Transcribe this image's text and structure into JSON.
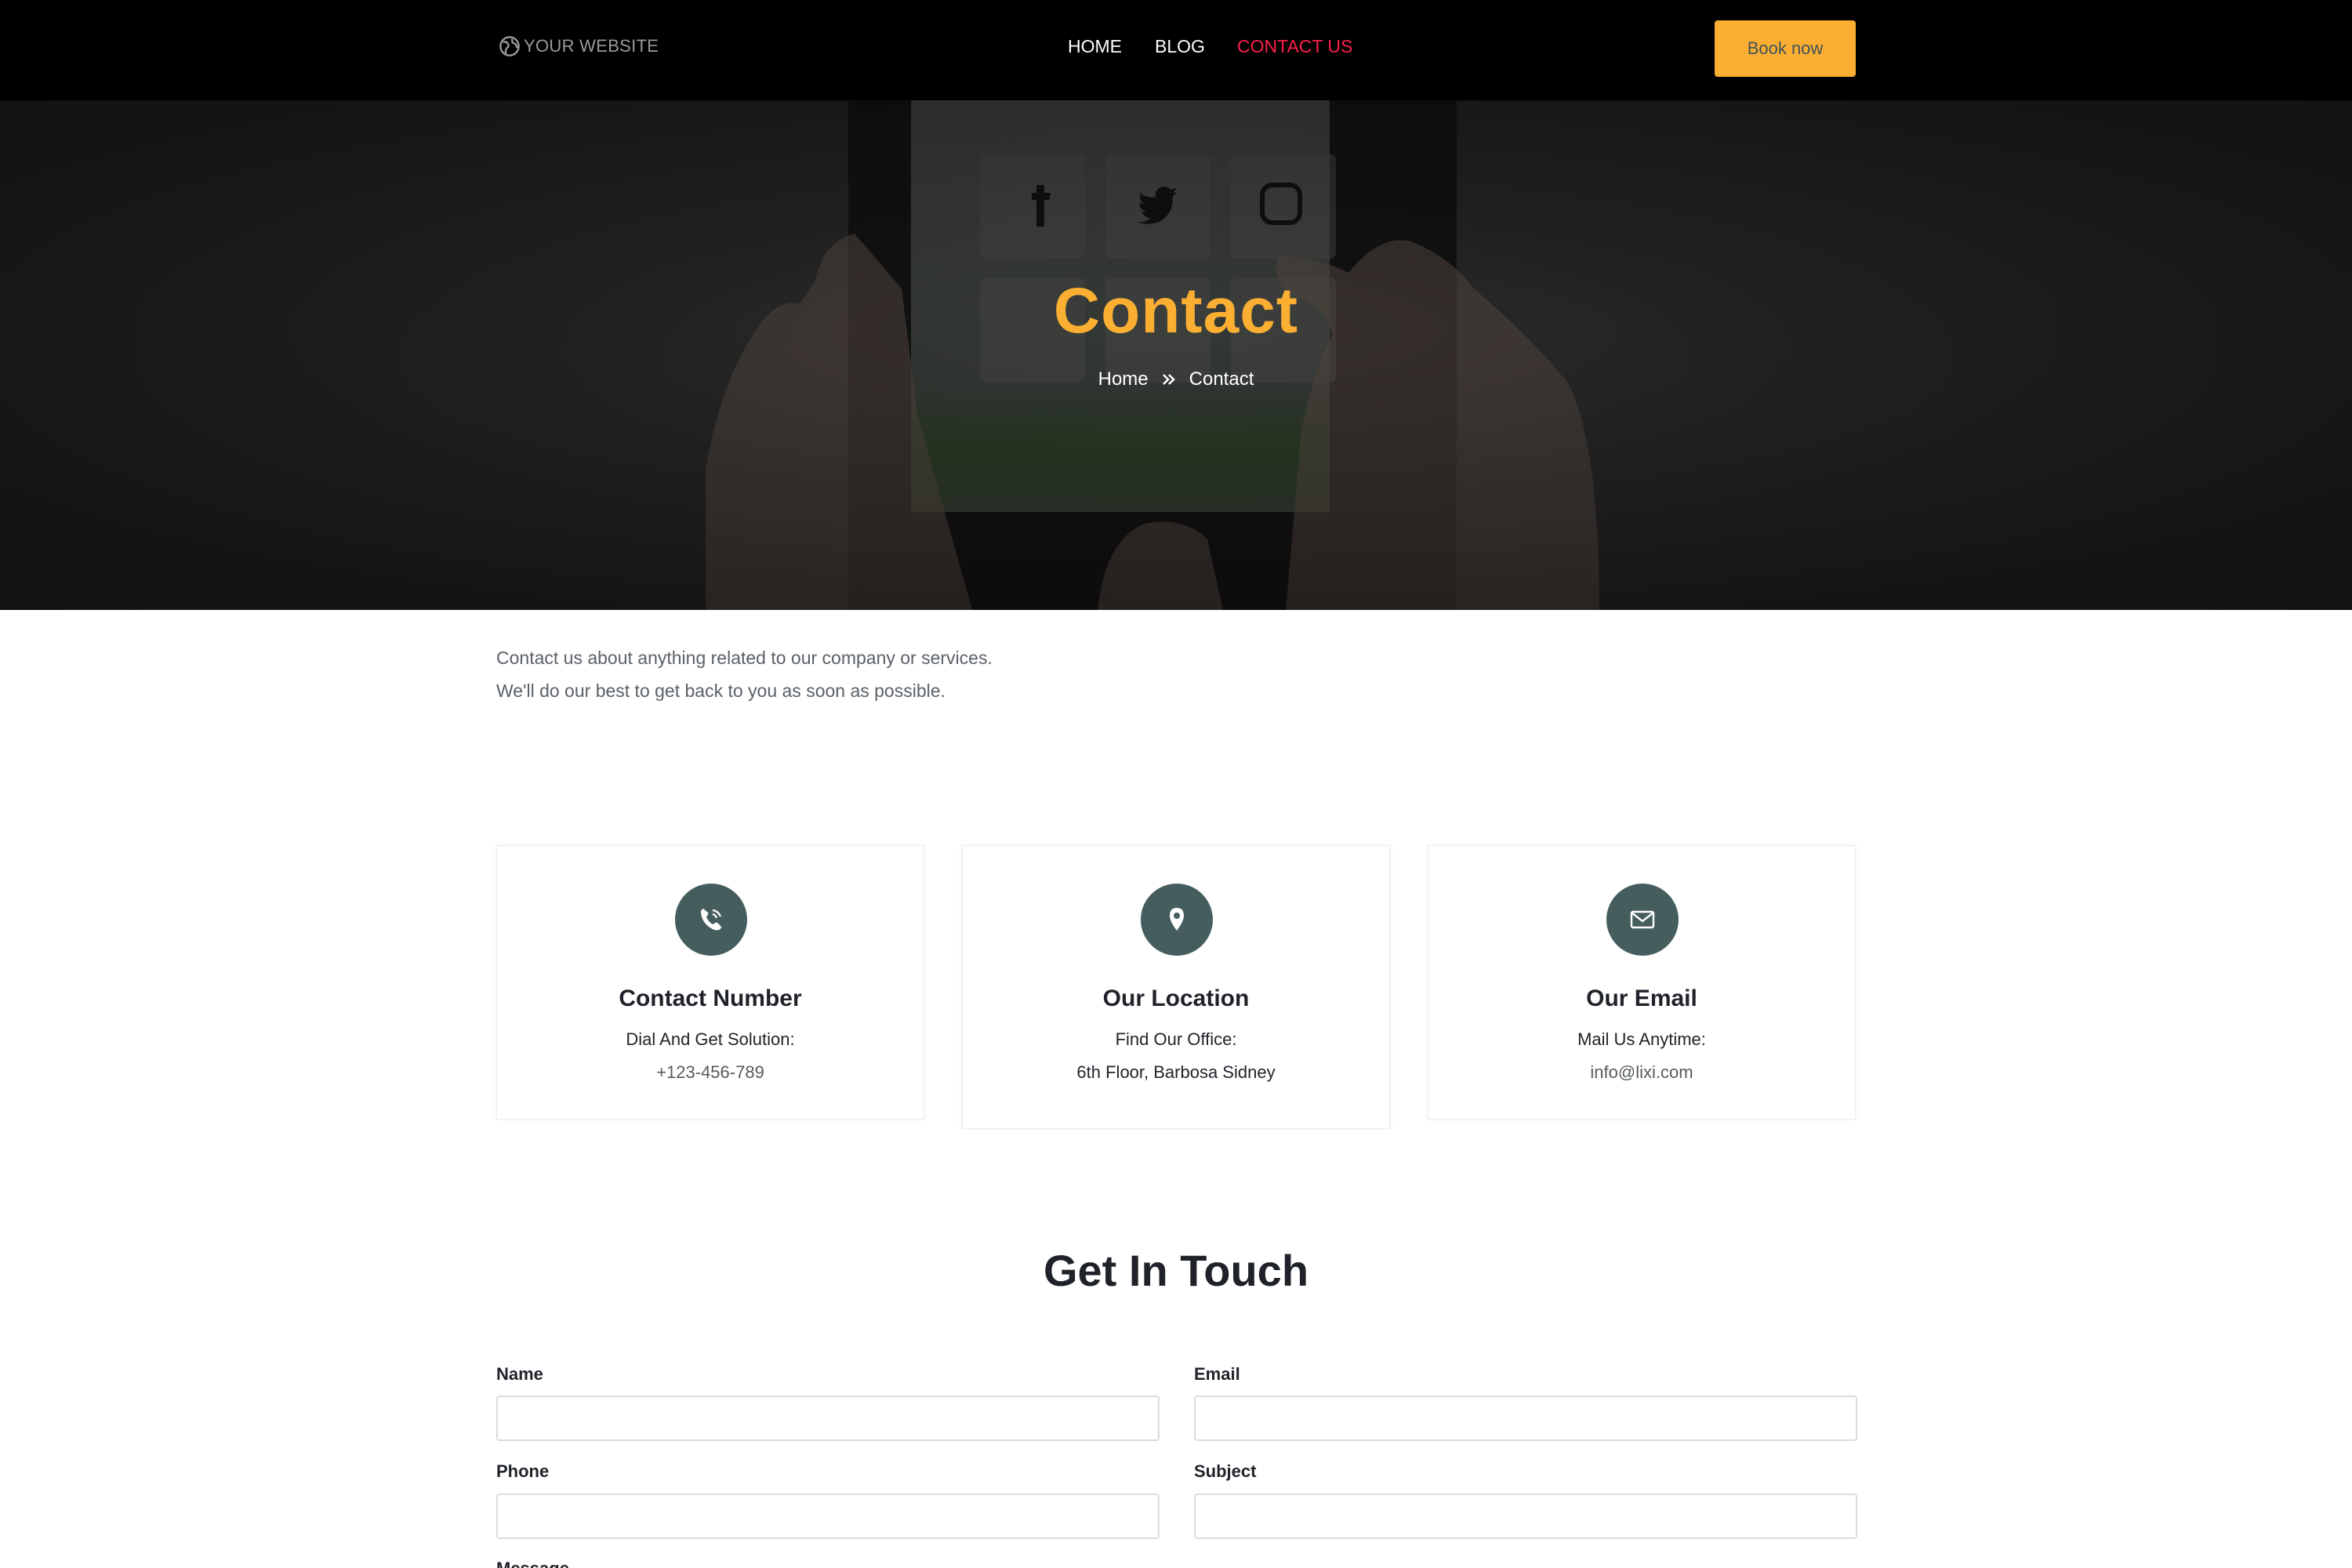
{
  "navbar": {
    "logo_text": "YOUR WEBSITE",
    "links": [
      {
        "label": "HOME",
        "active": false
      },
      {
        "label": "BLOG",
        "active": false
      },
      {
        "label": "CONTACT US",
        "active": true
      }
    ],
    "book_label": "Book now"
  },
  "hero": {
    "title": "Contact",
    "breadcrumb": {
      "home": "Home",
      "current": "Contact"
    }
  },
  "intro": {
    "line1": "Contact us about anything related to our company or services.",
    "line2": "We'll do our best to get back to you as soon as possible."
  },
  "cards": [
    {
      "icon": "phone-icon",
      "title": "Contact Number",
      "sub": "Dial And Get Solution:",
      "value": "+123-456-789"
    },
    {
      "icon": "location-pin-icon",
      "title": "Our Location",
      "sub": "Find Our Office:",
      "value": "6th Floor, Barbosa Sidney"
    },
    {
      "icon": "envelope-icon",
      "title": "Our Email",
      "sub": "Mail Us Anytime:",
      "value": "info@lixi.com"
    }
  ],
  "form": {
    "title": "Get In Touch",
    "name_label": "Name",
    "email_label": "Email",
    "phone_label": "Phone",
    "subject_label": "Subject",
    "message_label": "Message"
  },
  "colors": {
    "accent": "#fbaf32",
    "active_link": "#ff1f4b",
    "icon_bg": "#465d5d"
  }
}
